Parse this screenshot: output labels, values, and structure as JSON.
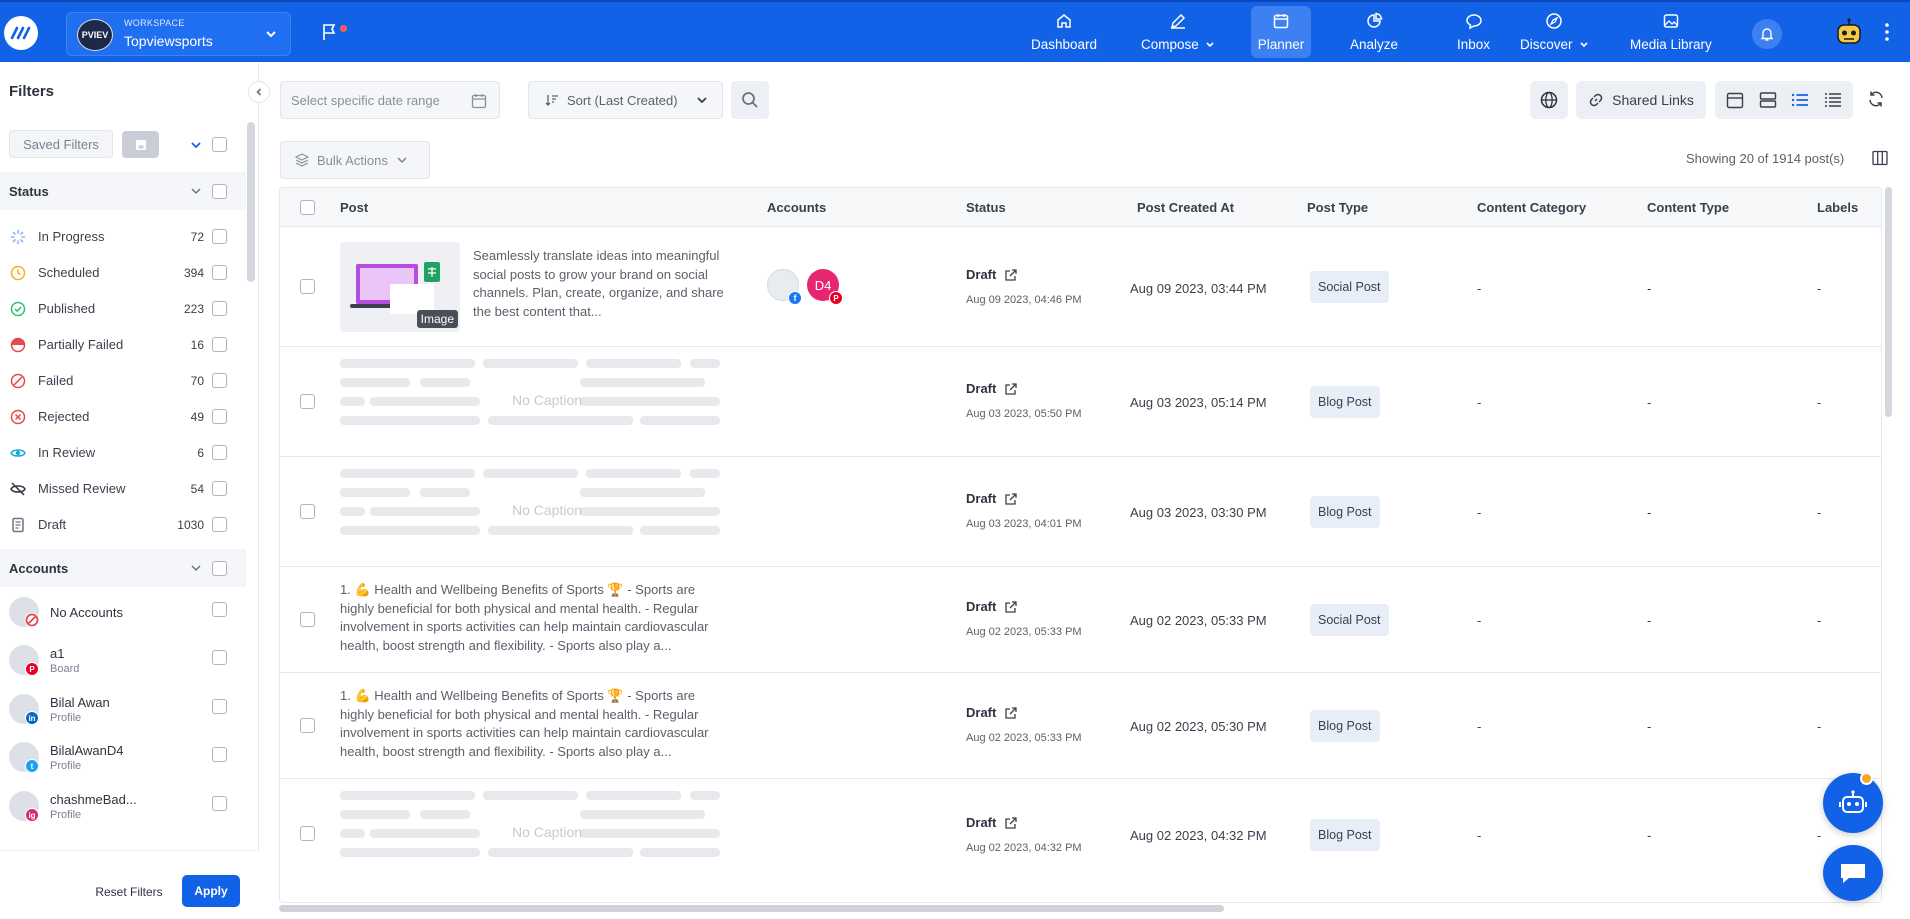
{
  "brand": {
    "accent": "#1262e8",
    "logo_icon": "logo-icon"
  },
  "workspace": {
    "label": "WORKSPACE",
    "name": "Topviewsports",
    "avatar_text": "PVIEV"
  },
  "nav": [
    {
      "label": "Dashboard",
      "icon": "home-icon",
      "dropdown": false
    },
    {
      "label": "Compose",
      "icon": "pencil-icon",
      "dropdown": true
    },
    {
      "label": "Planner",
      "icon": "calendar-icon",
      "dropdown": false,
      "active": true
    },
    {
      "label": "Analyze",
      "icon": "pie-chart-icon",
      "dropdown": false
    },
    {
      "label": "Inbox",
      "icon": "chat-icon",
      "dropdown": false
    },
    {
      "label": "Discover",
      "icon": "compass-icon",
      "dropdown": true
    },
    {
      "label": "Media Library",
      "icon": "image-icon",
      "dropdown": false
    }
  ],
  "sidebar": {
    "title": "Filters",
    "saved_filters": "Saved Filters",
    "status_title": "Status",
    "statuses": [
      {
        "label": "In Progress",
        "count": "72",
        "color": "#8fb3f7"
      },
      {
        "label": "Scheduled",
        "count": "394",
        "color": "#f2b01e"
      },
      {
        "label": "Published",
        "count": "223",
        "color": "#2fbf71"
      },
      {
        "label": "Partially Failed",
        "count": "16",
        "color": "#e5484d"
      },
      {
        "label": "Failed",
        "count": "70",
        "color": "#e5484d"
      },
      {
        "label": "Rejected",
        "count": "49",
        "color": "#e5484d"
      },
      {
        "label": "In Review",
        "count": "6",
        "color": "#17a9d1"
      },
      {
        "label": "Missed Review",
        "count": "54",
        "color": "#2d3340"
      },
      {
        "label": "Draft",
        "count": "1030",
        "color": "#6b7280"
      }
    ],
    "accounts_title": "Accounts",
    "accounts": [
      {
        "name": "No Accounts",
        "sub": ""
      },
      {
        "name": "a1",
        "sub": "Board",
        "badge": "pinterest"
      },
      {
        "name": "Bilal Awan",
        "sub": "Profile",
        "badge": "linkedin"
      },
      {
        "name": "BilalAwanD4",
        "sub": "Profile",
        "badge": "twitter"
      },
      {
        "name": "chashmeBad...",
        "sub": "Profile",
        "badge": "instagram"
      }
    ],
    "reset_label": "Reset Filters",
    "apply_label": "Apply"
  },
  "toolbar": {
    "date_placeholder": "Select specific date range",
    "sort_label": "Sort (Last Created)",
    "shared_links": "Shared Links",
    "bulk_actions": "Bulk Actions",
    "showing": "Showing 20 of 1914 post(s)"
  },
  "table": {
    "columns": [
      "Post",
      "Accounts",
      "Status",
      "Post Created At",
      "Post Type",
      "Content Category",
      "Content Type",
      "Labels"
    ],
    "rows": [
      {
        "caption": "Seamlessly translate ideas into meaningful social posts to grow your brand on social channels. Plan, create, organize, and share the best content that...",
        "media": "Image",
        "accounts_badge": "D4",
        "status": "Draft",
        "status_date": "Aug 09 2023, 04:46 PM",
        "created": "Aug 09 2023, 03:44 PM",
        "type": "Social Post",
        "category": "-",
        "content_type": "-",
        "labels": "-"
      },
      {
        "caption": "No Caption",
        "status": "Draft",
        "status_date": "Aug 03 2023, 05:50 PM",
        "created": "Aug 03 2023, 05:14 PM",
        "type": "Blog Post",
        "category": "-",
        "content_type": "-",
        "labels": "-"
      },
      {
        "caption": "No Caption",
        "status": "Draft",
        "status_date": "Aug 03 2023, 04:01 PM",
        "created": "Aug 03 2023, 03:30 PM",
        "type": "Blog Post",
        "category": "-",
        "content_type": "-",
        "labels": "-"
      },
      {
        "caption": "1. 💪 Health and Wellbeing Benefits of Sports 🏆 - Sports are highly beneficial for both physical and mental health. - Regular involvement in sports activities can help maintain cardiovascular health, boost strength and flexibility. - Sports also play a...",
        "status": "Draft",
        "status_date": "Aug 02 2023, 05:33 PM",
        "created": "Aug 02 2023, 05:33 PM",
        "type": "Social Post",
        "category": "-",
        "content_type": "-",
        "labels": "-"
      },
      {
        "caption": "1. 💪 Health and Wellbeing Benefits of Sports 🏆 - Sports are highly beneficial for both physical and mental health. - Regular involvement in sports activities can help maintain cardiovascular health, boost strength and flexibility. - Sports also play a...",
        "status": "Draft",
        "status_date": "Aug 02 2023, 05:33 PM",
        "created": "Aug 02 2023, 05:30 PM",
        "type": "Blog Post",
        "category": "-",
        "content_type": "-",
        "labels": "-"
      },
      {
        "caption": "No Caption",
        "status": "Draft",
        "status_date": "Aug 02 2023, 04:32 PM",
        "created": "Aug 02 2023, 04:32 PM",
        "type": "Blog Post",
        "category": "-",
        "content_type": "-",
        "labels": "-"
      }
    ]
  }
}
